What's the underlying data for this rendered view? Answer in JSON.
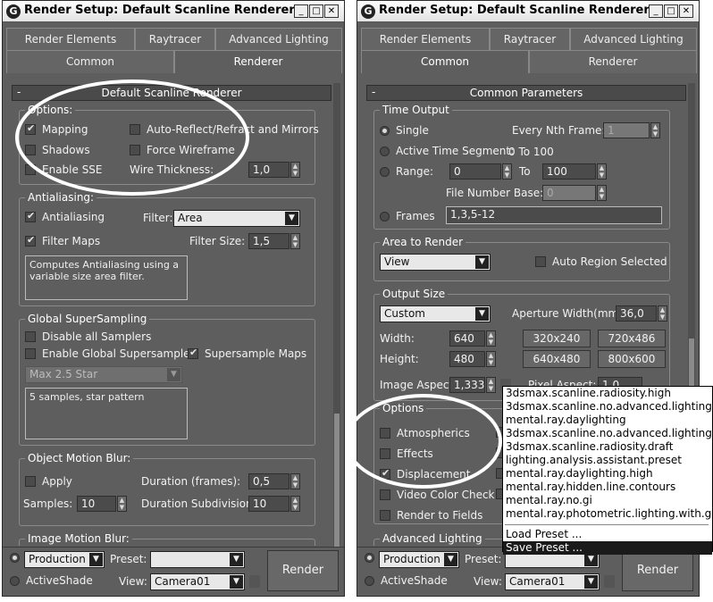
{
  "left": {
    "title": "Render Setup: Default Scanline Renderer",
    "tabs": {
      "render_elements": "Render Elements",
      "raytracer": "Raytracer",
      "advanced_lighting": "Advanced Lighting",
      "common": "Common",
      "renderer": "Renderer"
    },
    "rollout": "Default Scanline Renderer",
    "options": {
      "label": "Options:",
      "mapping": "Mapping",
      "auto_reflect": "Auto-Reflect/Refract and Mirrors",
      "shadows": "Shadows",
      "force_wireframe": "Force Wireframe",
      "enable_sse": "Enable SSE",
      "wire_thickness": "Wire Thickness:",
      "wire_thickness_value": "1,0"
    },
    "antialiasing": {
      "label": "Antialiasing:",
      "antialiasing": "Antialiasing",
      "filter": "Filter:",
      "filter_value": "Area",
      "filter_maps": "Filter Maps",
      "filter_size": "Filter Size:",
      "filter_size_value": "1,5",
      "description": "Computes Antialiasing using a\nvariable size area filter."
    },
    "supersampling": {
      "label": "Global SuperSampling",
      "disable_all": "Disable all Samplers",
      "enable_global": "Enable Global Supersampler",
      "supersample_maps": "Supersample Maps",
      "sampler": "Max 2.5 Star",
      "description": "5 samples, star pattern"
    },
    "motion_blur": {
      "label": "Object Motion Blur:",
      "apply": "Apply",
      "duration": "Duration (frames):",
      "duration_value": "0,5",
      "samples": "Samples:",
      "samples_value": "10",
      "subdivisions": "Duration Subdivisions:",
      "subdivisions_value": "10"
    },
    "next_rollout": "Image Motion Blur:",
    "bottom": {
      "production": "Production",
      "preset": "Preset:",
      "preset_value": "",
      "activeshade": "ActiveShade",
      "view": "View:",
      "view_value": "Camera01",
      "render": "Render"
    }
  },
  "right": {
    "title": "Render Setup: Default Scanline Renderer",
    "tabs": {
      "render_elements": "Render Elements",
      "raytracer": "Raytracer",
      "advanced_lighting": "Advanced Lighting",
      "common": "Common",
      "renderer": "Renderer"
    },
    "rollout": "Common Parameters",
    "time_output": {
      "label": "Time Output",
      "single": "Single",
      "every_nth": "Every Nth Frame:",
      "every_nth_value": "1",
      "active_segment": "Active Time Segment:",
      "active_segment_value": "0 To 100",
      "range": "Range:",
      "range_from": "0",
      "to": "To",
      "range_to": "100",
      "file_number_base": "File Number Base:",
      "file_number_base_value": "0",
      "frames": "Frames",
      "frames_value": "1,3,5-12"
    },
    "area_to_render": {
      "label": "Area to Render",
      "value": "View",
      "auto_region": "Auto Region Selected"
    },
    "output_size": {
      "label": "Output Size",
      "preset": "Custom",
      "aperture": "Aperture Width(mm):",
      "aperture_value": "36,0",
      "width": "Width:",
      "width_value": "640",
      "height": "Height:",
      "height_value": "480",
      "btn_320": "320x240",
      "btn_720": "720x486",
      "btn_640": "640x480",
      "btn_800": "800x600",
      "image_aspect": "Image Aspect:",
      "image_aspect_value": "1,333",
      "pixel_aspect": "Pixel Aspect:",
      "pixel_aspect_value": "1,0"
    },
    "options": {
      "label": "Options",
      "atmospherics": "Atmospherics",
      "effects": "Effects",
      "displacement": "Displacement",
      "video_color_check": "Video Color Check",
      "render_to_fields": "Render to Fields"
    },
    "advanced_lighting": "Advanced Lighting",
    "preset_menu": [
      "3dsmax.scanline.radiosity.high",
      "3dsmax.scanline.no.advanced.lighting.high",
      "mental.ray.daylighting",
      "3dsmax.scanline.no.advanced.lighting.draft",
      "3dsmax.scanline.radiosity.draft",
      "lighting.analysis.assistant.preset",
      "mental.ray.daylighting.high",
      "mental.ray.hidden.line.contours",
      "mental.ray.no.gi",
      "mental.ray.photometric.lighting.with.gi"
    ],
    "load_preset": "Load Preset ...",
    "save_preset": "Save Preset ...",
    "bottom": {
      "production": "Production",
      "preset": "Preset:",
      "preset_value": "",
      "activeshade": "ActiveShade",
      "view": "View:",
      "view_value": "Camera01",
      "render": "Render"
    }
  }
}
